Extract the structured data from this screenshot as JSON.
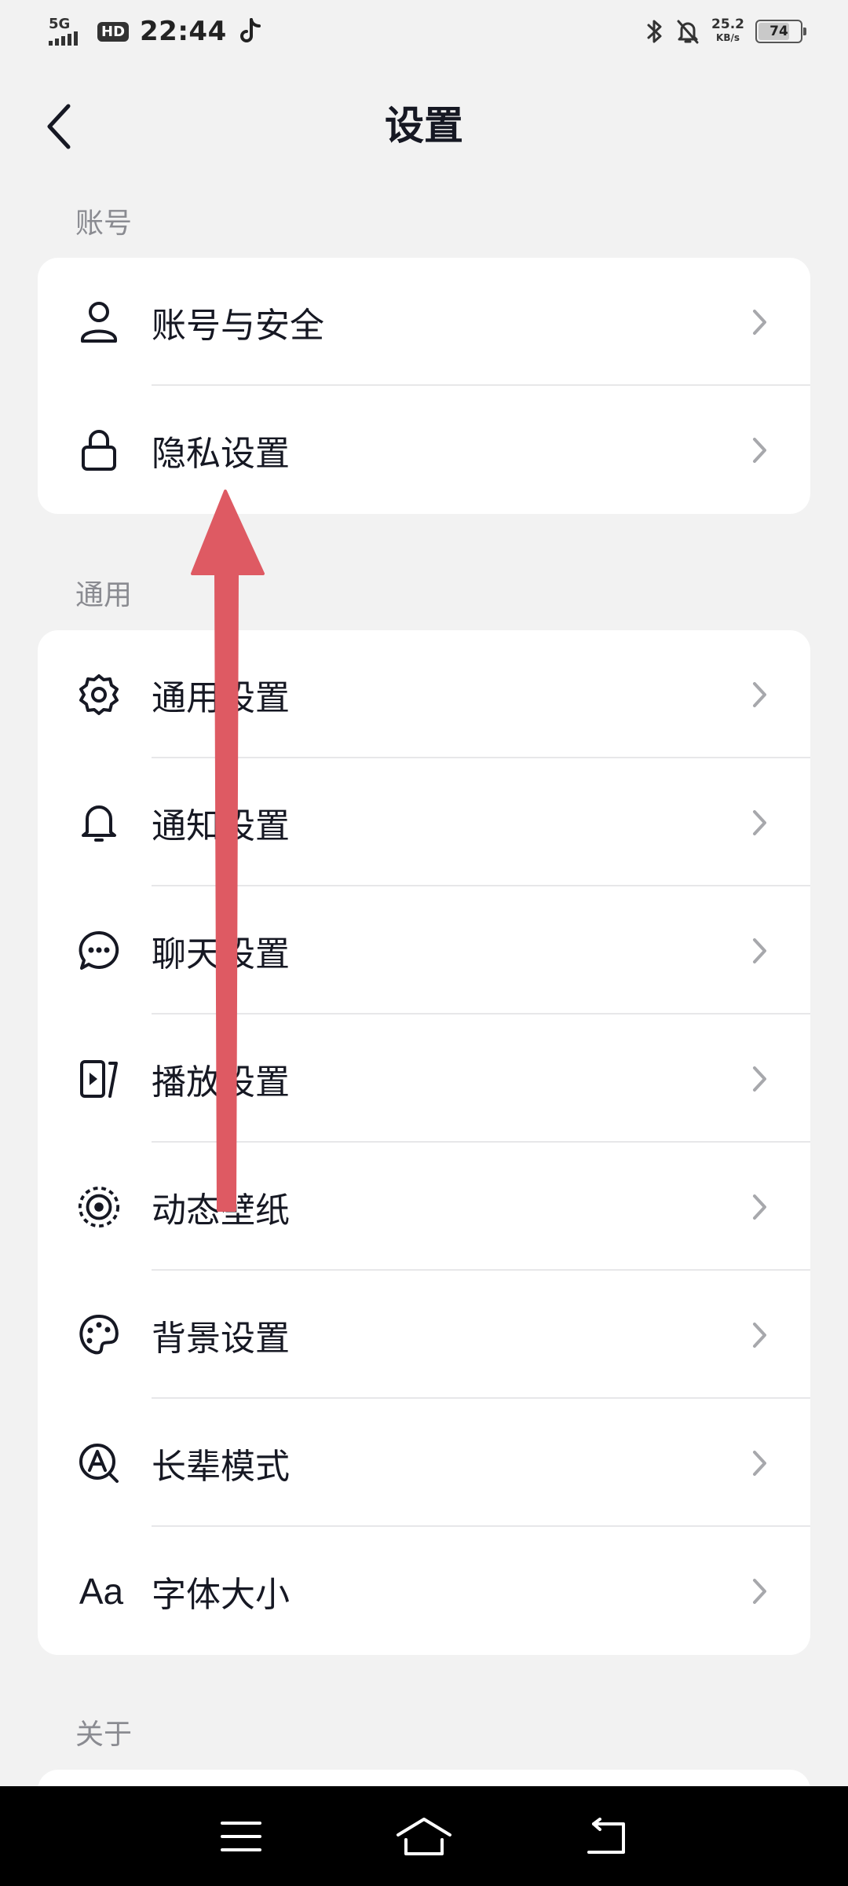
{
  "status_bar": {
    "network": "5G",
    "hd": "HD",
    "time": "22:44",
    "rate_value": "25.2",
    "rate_unit": "KB/s",
    "battery": "74"
  },
  "header": {
    "title": "设置"
  },
  "sections": {
    "account": {
      "label": "账号",
      "items": [
        {
          "label": "账号与安全",
          "icon": "user-icon"
        },
        {
          "label": "隐私设置",
          "icon": "lock-icon"
        }
      ]
    },
    "general": {
      "label": "通用",
      "items": [
        {
          "label": "通用设置",
          "icon": "gear-icon"
        },
        {
          "label": "通知设置",
          "icon": "bell-icon"
        },
        {
          "label": "聊天设置",
          "icon": "chat-bubble-icon"
        },
        {
          "label": "播放设置",
          "icon": "play-video-icon"
        },
        {
          "label": "动态壁纸",
          "icon": "live-wallpaper-icon"
        },
        {
          "label": "背景设置",
          "icon": "palette-icon"
        },
        {
          "label": "长辈模式",
          "icon": "elder-mode-icon"
        },
        {
          "label": "字体大小",
          "icon": "font-size-icon",
          "glyph": "Aa"
        }
      ]
    },
    "about": {
      "label": "关于"
    }
  },
  "colors": {
    "background": "#f2f2f2",
    "card": "#ffffff",
    "text": "#161823",
    "secondary_text": "#8a8b91",
    "arrow": "#de5a63"
  }
}
